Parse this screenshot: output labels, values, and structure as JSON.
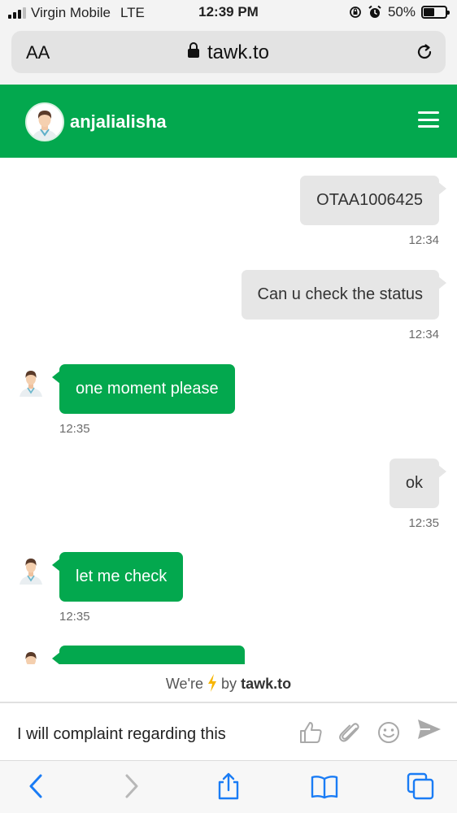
{
  "status_bar": {
    "carrier": "Virgin Mobile",
    "network": "LTE",
    "time": "12:39 PM",
    "battery_percent": "50%",
    "battery_level": 0.5
  },
  "browser": {
    "text_size_label": "AA",
    "url": "tawk.to"
  },
  "chat_header": {
    "agent_name": "anjalialisha"
  },
  "messages": [
    {
      "direction": "out",
      "text": "OTAA1006425",
      "time": "12:34"
    },
    {
      "direction": "out",
      "text": "Can u check the status",
      "time": "12:34"
    },
    {
      "direction": "in",
      "text": "one moment please",
      "time": "12:35"
    },
    {
      "direction": "out",
      "text": "ok",
      "time": "12:35"
    },
    {
      "direction": "in",
      "text": "let me check",
      "time": "12:35"
    },
    {
      "direction": "in",
      "text": "",
      "time": ""
    }
  ],
  "powered_by": {
    "prefix": "We're",
    "middle": "by",
    "brand": "tawk.to"
  },
  "composer": {
    "input_value": "I will complaint regarding this"
  },
  "colors": {
    "brand_green": "#03a84e",
    "outgoing_bubble": "#e6e6e6",
    "safari_blue": "#1a7cf5"
  },
  "icons": {
    "composer": [
      "thumbs-up-icon",
      "paperclip-icon",
      "smiley-icon",
      "send-icon"
    ],
    "toolbar": [
      "back-icon",
      "forward-icon",
      "share-icon",
      "bookmarks-icon",
      "tabs-icon"
    ]
  }
}
